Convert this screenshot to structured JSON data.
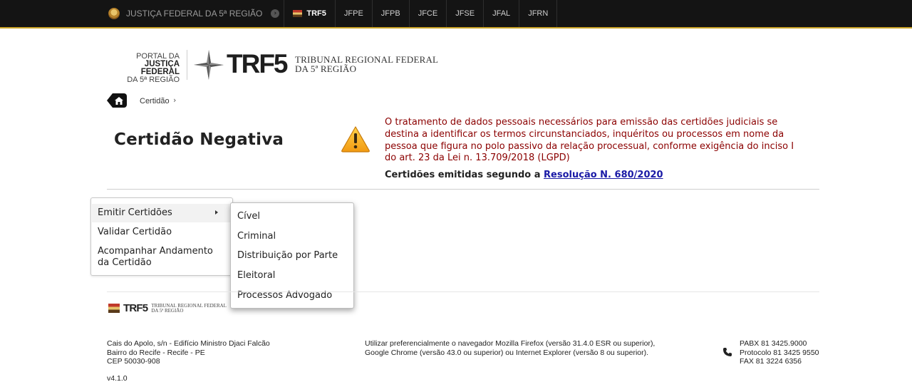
{
  "topbar": {
    "portal_label": "JUSTIÇA FEDERAL DA 5ª REGIÃO",
    "items": [
      {
        "label": "TRF5",
        "active": true
      },
      {
        "label": "JFPE",
        "active": false
      },
      {
        "label": "JFPB",
        "active": false
      },
      {
        "label": "JFCE",
        "active": false
      },
      {
        "label": "JFSE",
        "active": false
      },
      {
        "label": "JFAL",
        "active": false
      },
      {
        "label": "JFRN",
        "active": false
      }
    ]
  },
  "header": {
    "portal_line1": "PORTAL DA",
    "portal_line2": "JUSTIÇA FEDERAL",
    "portal_line3": "DA 5ª REGIÃO",
    "logo_text": "TRF5",
    "tribunal_line1": "TRIBUNAL REGIONAL FEDERAL",
    "tribunal_line2": "DA 5ª REGIÃO"
  },
  "breadcrumb": {
    "current": "Certidão",
    "separator": "›"
  },
  "main": {
    "title": "Certidão Negativa",
    "notice": "O tratamento de dados pessoais necessários para emissão das certidões judiciais se destina a identificar os termos circunstanciados, inquéritos ou processos em nome da pessoa que figura no polo passivo da relação processual, conforme exigência do inciso I do art. 23 da Lei n. 13.709/2018 (LGPD)",
    "resolution_prefix": "Certidões emitidas segundo a ",
    "resolution_link": "Resolução N. 680/2020"
  },
  "menu": {
    "items": [
      {
        "label": "Emitir Certidões"
      },
      {
        "label": "Validar Certidão"
      },
      {
        "label": "Acompanhar Andamento",
        "label2": "da Certidão"
      }
    ],
    "submenu": [
      {
        "label": "Cível"
      },
      {
        "label": "Criminal"
      },
      {
        "label": "Distribuição por Parte"
      },
      {
        "label": "Eleitoral"
      },
      {
        "label": "Processos Advogado"
      }
    ]
  },
  "footer": {
    "logo_text": "TRF5",
    "tribunal_line1": "TRIBUNAL REGIONAL FEDERAL",
    "tribunal_line2": "DA 5ª REGIÃO",
    "address_line1": "Cais do Apolo, s/n - Edifício Ministro Djaci Falcão",
    "address_line2": "Bairro do Recife - Recife - PE",
    "address_line3": "CEP 50030-908",
    "browser_line1": "Utilizar preferencialmente o navegador Mozilla Firefox (versão 31.4.0 ESR ou superior),",
    "browser_line2": "Google Chrome (versão 43.0 ou superior) ou Internet Explorer (versão 8 ou superior).",
    "phone_pabx": "PABX 81 3425.9000",
    "phone_protocolo": "Protocolo 81 3425 9550",
    "phone_fax": "FAX 81 3224 6356",
    "version": "v4.1.0"
  }
}
